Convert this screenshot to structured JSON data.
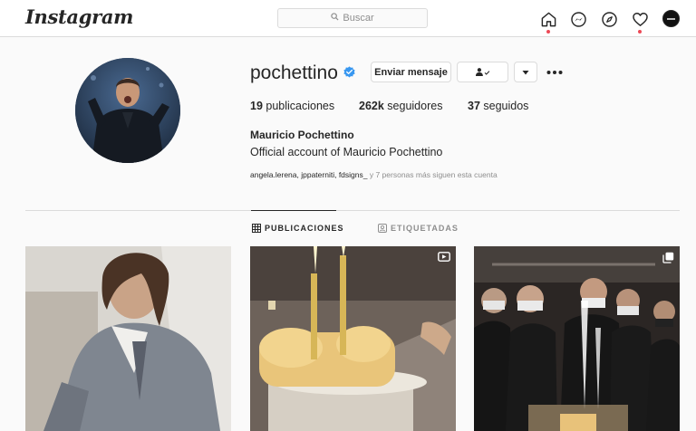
{
  "nav": {
    "logo": "Instagram",
    "search_placeholder": "Buscar",
    "icons": [
      "home-icon",
      "messenger-icon",
      "explore-icon",
      "activity-heart-icon",
      "profile-avatar"
    ]
  },
  "profile": {
    "username": "pochettino",
    "verified": true,
    "buttons": {
      "message": "Enviar mensaje"
    },
    "stats": {
      "posts_count": "19",
      "posts_label": "publicaciones",
      "followers_count": "262k",
      "followers_label": "seguidores",
      "following_count": "37",
      "following_label": "seguidos"
    },
    "full_name": "Mauricio Pochettino",
    "bio": "Official account of Mauricio Pochettino",
    "followed_by_users": "angela.lerena, jppaterniti, fdsigns_",
    "followed_by_suffix": "y 7 personas más siguen esta cuenta"
  },
  "tabs": [
    {
      "label": "PUBLICACIONES",
      "active": true
    },
    {
      "label": "ETIQUETADAS",
      "active": false
    }
  ],
  "colors": {
    "notification_dot": "#ed4956",
    "verified_blue": "#3897f0",
    "border": "#dbdbdb",
    "muted_text": "#8e8e8e"
  }
}
